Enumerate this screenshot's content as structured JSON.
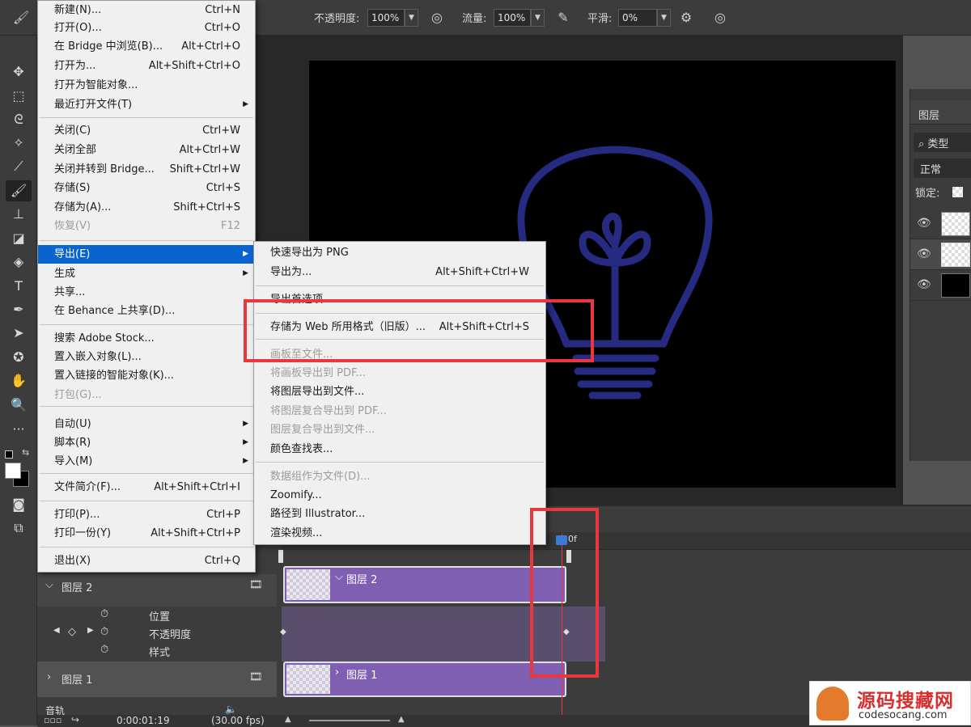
{
  "options_bar": {
    "opacity_label": "不透明度:",
    "opacity_value": "100%",
    "flow_label": "流量:",
    "flow_value": "100%",
    "smooth_label": "平滑:",
    "smooth_value": "0%"
  },
  "layers_panel": {
    "tab": "图层",
    "filter": "类型",
    "blend": "正常",
    "lock_label": "锁定:"
  },
  "file_menu": [
    {
      "label": "新建(N)...",
      "shortcut": "Ctrl+N"
    },
    {
      "label": "打开(O)...",
      "shortcut": "Ctrl+O"
    },
    {
      "label": "在 Bridge 中浏览(B)...",
      "shortcut": "Alt+Ctrl+O"
    },
    {
      "label": "打开为...",
      "shortcut": "Alt+Shift+Ctrl+O"
    },
    {
      "label": "打开为智能对象...",
      "shortcut": ""
    },
    {
      "label": "最近打开文件(T)",
      "shortcut": ""
    },
    {
      "label": "关闭(C)",
      "shortcut": "Ctrl+W"
    },
    {
      "label": "关闭全部",
      "shortcut": "Alt+Ctrl+W"
    },
    {
      "label": "关闭并转到 Bridge...",
      "shortcut": "Shift+Ctrl+W"
    },
    {
      "label": "存储(S)",
      "shortcut": "Ctrl+S"
    },
    {
      "label": "存储为(A)...",
      "shortcut": "Shift+Ctrl+S"
    },
    {
      "label": "恢复(V)",
      "shortcut": "F12"
    },
    {
      "label": "导出(E)",
      "shortcut": ""
    },
    {
      "label": "生成",
      "shortcut": ""
    },
    {
      "label": "共享...",
      "shortcut": ""
    },
    {
      "label": "在 Behance 上共享(D)...",
      "shortcut": ""
    },
    {
      "label": "搜索 Adobe Stock...",
      "shortcut": ""
    },
    {
      "label": "置入嵌入对象(L)...",
      "shortcut": ""
    },
    {
      "label": "置入链接的智能对象(K)...",
      "shortcut": ""
    },
    {
      "label": "打包(G)...",
      "shortcut": ""
    },
    {
      "label": "自动(U)",
      "shortcut": ""
    },
    {
      "label": "脚本(R)",
      "shortcut": ""
    },
    {
      "label": "导入(M)",
      "shortcut": ""
    },
    {
      "label": "文件简介(F)...",
      "shortcut": "Alt+Shift+Ctrl+I"
    },
    {
      "label": "打印(P)...",
      "shortcut": "Ctrl+P"
    },
    {
      "label": "打印一份(Y)",
      "shortcut": "Alt+Shift+Ctrl+P"
    },
    {
      "label": "退出(X)",
      "shortcut": "Ctrl+Q"
    }
  ],
  "export_submenu": [
    {
      "label": "快速导出为 PNG",
      "shortcut": ""
    },
    {
      "label": "导出为...",
      "shortcut": "Alt+Shift+Ctrl+W"
    },
    {
      "label": "导出首选项...",
      "shortcut": ""
    },
    {
      "label": "存储为 Web 所用格式（旧版）...",
      "shortcut": "Alt+Shift+Ctrl+S"
    },
    {
      "label": "画板至文件...",
      "shortcut": ""
    },
    {
      "label": "将画板导出到 PDF...",
      "shortcut": ""
    },
    {
      "label": "将图层导出到文件...",
      "shortcut": ""
    },
    {
      "label": "将图层复合导出到 PDF...",
      "shortcut": ""
    },
    {
      "label": "图层复合导出到文件...",
      "shortcut": ""
    },
    {
      "label": "颜色查找表...",
      "shortcut": ""
    },
    {
      "label": "数据组作为文件(D)...",
      "shortcut": ""
    },
    {
      "label": "Zoomify...",
      "shortcut": ""
    },
    {
      "label": "路径到 Illustrator...",
      "shortcut": ""
    },
    {
      "label": "渲染视频...",
      "shortcut": ""
    }
  ],
  "timeline": {
    "layer2": "图层 2",
    "prop_position": "位置",
    "prop_opacity": "不透明度",
    "prop_style": "样式",
    "layer1": "图层 1",
    "audio": "音轨",
    "clip2": "图层 2",
    "clip1": "图层 1",
    "playhead_label": "0f",
    "timecode": "0:00:01:19",
    "fps": "(30.00 fps)"
  },
  "watermark": {
    "title": "源码搜藏网",
    "url": "codesocang.com"
  }
}
